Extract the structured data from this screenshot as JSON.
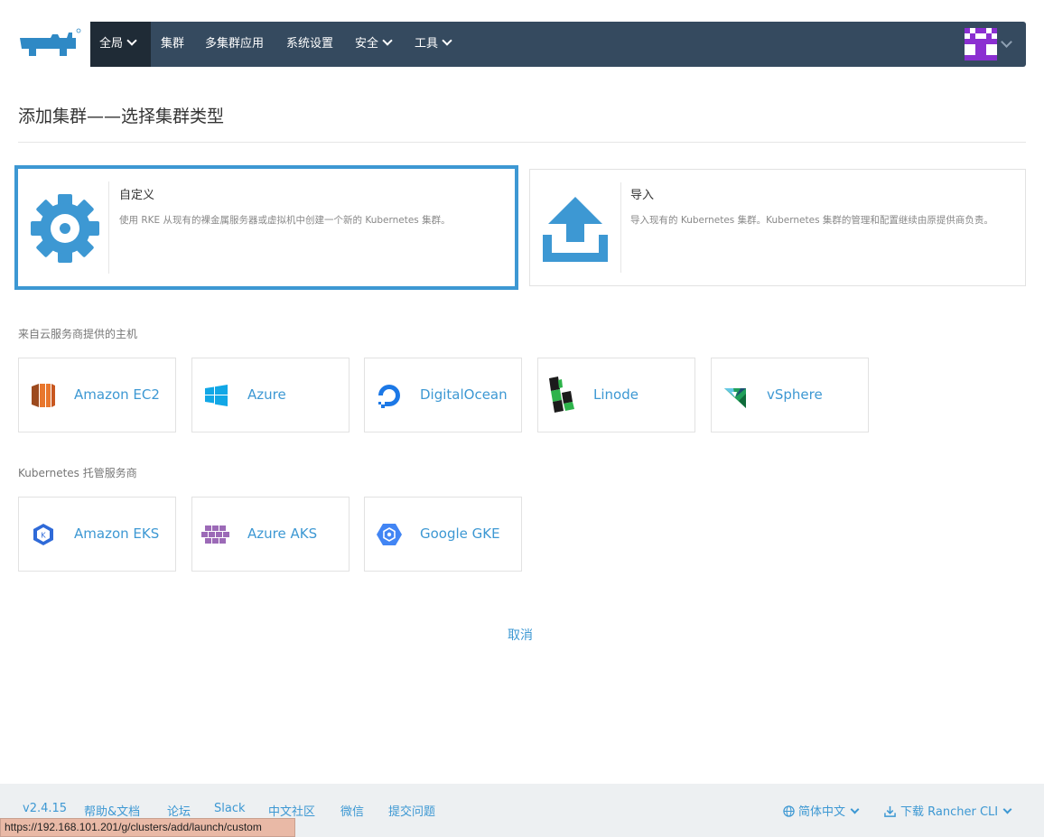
{
  "nav": {
    "items": [
      {
        "label": "全局",
        "dropdown": true,
        "active": true
      },
      {
        "label": "集群",
        "dropdown": false
      },
      {
        "label": "多集群应用",
        "dropdown": false
      },
      {
        "label": "系统设置",
        "dropdown": false
      },
      {
        "label": "安全",
        "dropdown": true
      },
      {
        "label": "工具",
        "dropdown": true
      }
    ]
  },
  "page": {
    "title": "添加集群——选择集群类型"
  },
  "cards": {
    "custom": {
      "title": "自定义",
      "desc": "使用 RKE 从现有的裸金属服务器或虚拟机中创建一个新的 Kubernetes 集群。",
      "icon": "gear-icon"
    },
    "import": {
      "title": "导入",
      "desc": "导入现有的 Kubernetes 集群。Kubernetes 集群的管理和配置继续由原提供商负责。",
      "icon": "upload-icon"
    }
  },
  "cloud": {
    "label": "来自云服务商提供的主机",
    "providers": [
      "Amazon EC2",
      "Azure",
      "DigitalOcean",
      "Linode",
      "vSphere"
    ]
  },
  "hosted": {
    "label": "Kubernetes 托管服务商",
    "providers": [
      "Amazon EKS",
      "Azure AKS",
      "Google GKE"
    ]
  },
  "actions": {
    "cancel": "取消"
  },
  "footer": {
    "version": "v2.4.15",
    "links": [
      "帮助&文档",
      "论坛",
      "Slack",
      "中文社区",
      "微信",
      "提交问题"
    ],
    "language": "简体中文",
    "download": "下载 Rancher CLI"
  },
  "status_url": "https://192.168.101.201/g/clusters/add/launch/custom",
  "colors": {
    "navbar": "#354a5f",
    "accent": "#3d98d3"
  }
}
